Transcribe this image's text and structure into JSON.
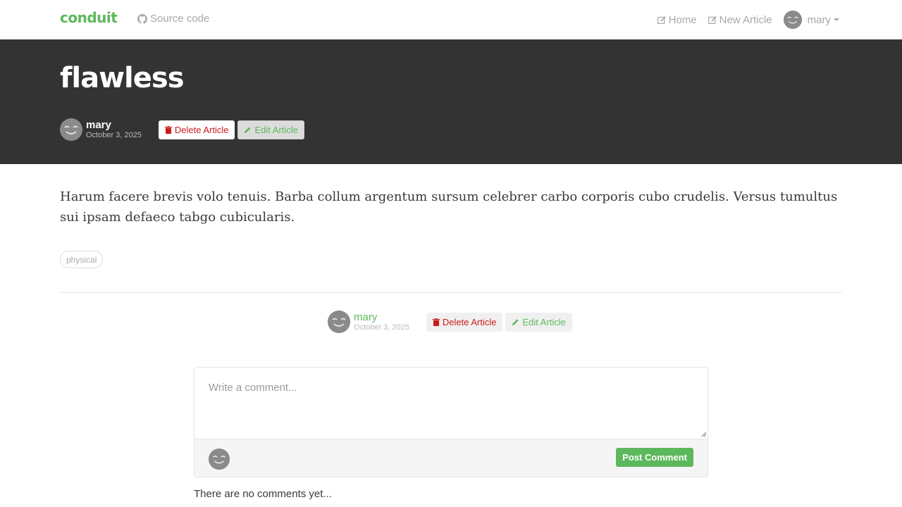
{
  "navbar": {
    "brand": "conduit",
    "source_code": "Source code",
    "home": "Home",
    "new_article": "New Article",
    "user": "mary"
  },
  "article": {
    "title": "flawless",
    "author": "mary",
    "date": "October 3, 2025",
    "delete_label": "Delete Article",
    "edit_label": "Edit Article",
    "body": "Harum facere brevis volo tenuis. Barba collum argentum sursum celebrer carbo corporis cubo crudelis. Versus tumultus sui ipsam defaeco tabgo cubicularis.",
    "tags": [
      "physical"
    ]
  },
  "comments": {
    "placeholder": "Write a comment...",
    "post_label": "Post Comment",
    "empty_text": "There are no comments yet..."
  },
  "colors": {
    "brand": "#5cb85c",
    "banner_bg": "#333333",
    "danger": "#cc1b1b"
  }
}
